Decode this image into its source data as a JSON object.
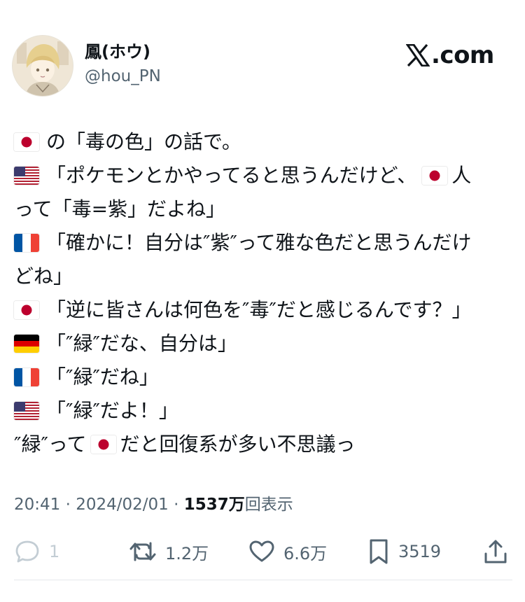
{
  "user": {
    "display_name": "鳳(ホウ)",
    "handle": "@hou_PN"
  },
  "brand": {
    "logo_text": ".com"
  },
  "tweet_lines": [
    {
      "flag": "jp",
      "text": "の「毒の色」の話で。"
    },
    {
      "flag": "us",
      "text": "「ポケモンとかやってると思うんだけど、"
    },
    {
      "flag": "",
      "text": "って「毒=紫」だよね」"
    },
    {
      "flag": "fr",
      "text": "「確かに！自分は″紫″って雅な色だと思うんだけ"
    },
    {
      "flag": "",
      "text": "どね」"
    },
    {
      "flag": "jp",
      "text": "「逆に皆さんは何色を″毒″だと感じるんです？」"
    },
    {
      "flag": "de",
      "text": "「″緑″だな、自分は」"
    },
    {
      "flag": "fr",
      "text": "「″緑″だね」"
    },
    {
      "flag": "us",
      "text": "「″緑″だよ！」"
    },
    {
      "flag": "",
      "text": "″緑″って"
    }
  ],
  "line_tails": {
    "line1": "人",
    "line9": "だと回復系が多い不思議っ"
  },
  "meta": {
    "time": "20:41",
    "date": "2024/02/01",
    "views": "1537万",
    "views_label": "回表示"
  },
  "actions": {
    "replies": "1",
    "reposts": "1.2万",
    "likes": "6.6万",
    "bookmarks": "3519"
  },
  "colors": {
    "text": "#0f1419",
    "secondary": "#536471",
    "reply_muted": "#c3cdd4"
  }
}
